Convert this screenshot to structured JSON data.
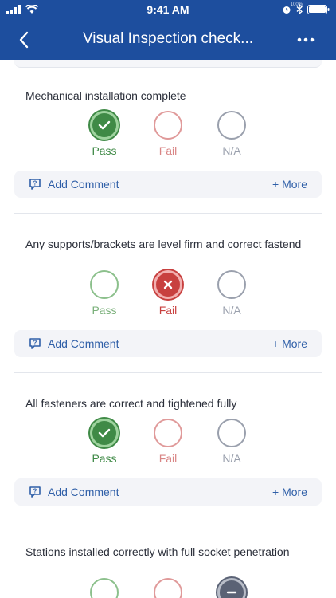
{
  "status_bar": {
    "time": "9:41 AM",
    "battery_percent": "100%"
  },
  "nav": {
    "title": "Visual Inspection check..."
  },
  "options": {
    "pass": "Pass",
    "fail": "Fail",
    "na": "N/A"
  },
  "actions": {
    "add_comment": "Add Comment",
    "more": "+ More"
  },
  "items": [
    {
      "question": "Mechanical installation complete",
      "selected": "pass"
    },
    {
      "question": "Any supports/brackets are level firm and correct fastend",
      "selected": "fail"
    },
    {
      "question": "All fasteners are correct and tightened fully",
      "selected": "pass"
    },
    {
      "question": "Stations installed correctly with full socket penetration",
      "selected": "na"
    }
  ],
  "colors": {
    "header": "#1d4e9e",
    "pass": "#3f8a46",
    "fail": "#c8403f",
    "na": "#5a6275",
    "link": "#2f5fa8"
  }
}
